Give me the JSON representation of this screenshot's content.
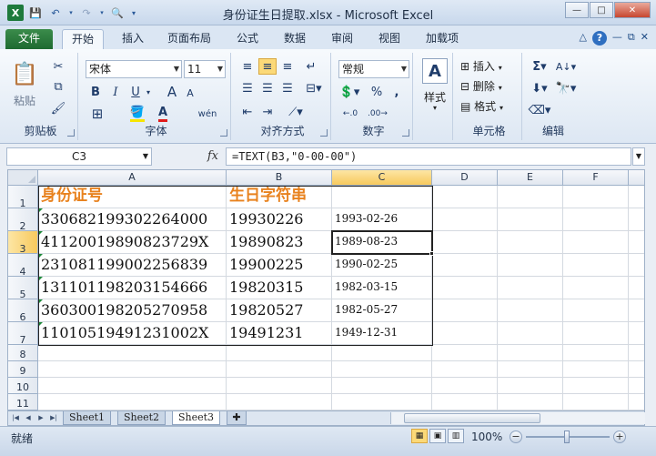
{
  "window": {
    "title": "身份证生日提取.xlsx  -  Microsoft Excel",
    "app_icon_letter": "X",
    "minimize": "—",
    "maximize": "□",
    "close": "✕"
  },
  "ribbon_tabs": [
    {
      "label": "文件"
    },
    {
      "label": "开始"
    },
    {
      "label": "插入"
    },
    {
      "label": "页面布局"
    },
    {
      "label": "公式"
    },
    {
      "label": "数据"
    },
    {
      "label": "审阅"
    },
    {
      "label": "视图"
    },
    {
      "label": "加载项"
    }
  ],
  "active_tab": "开始",
  "ribbon": {
    "clipboard": {
      "label": "剪贴板",
      "paste": "粘贴"
    },
    "font": {
      "label": "字体",
      "name": "宋体",
      "size": "11",
      "bold": "B",
      "italic": "I",
      "underline": "U",
      "grow": "A",
      "shrink": "A"
    },
    "alignment": {
      "label": "对齐方式"
    },
    "number": {
      "label": "数字",
      "format": "常规",
      "percent": "%",
      "comma": ","
    },
    "styles": {
      "label": "样式"
    },
    "cells": {
      "label": "单元格",
      "insert": "插入",
      "delete": "删除",
      "format": "格式"
    },
    "editing": {
      "label": "编辑"
    }
  },
  "formula_bar": {
    "name_box": "C3",
    "fx": "fx",
    "formula": "=TEXT(B3,\"0-00-00\")"
  },
  "grid": {
    "columns": [
      "A",
      "B",
      "C",
      "D",
      "E",
      "F"
    ],
    "rows": [
      "1",
      "2",
      "3",
      "4",
      "5",
      "6",
      "7",
      "8",
      "9",
      "10",
      "11"
    ],
    "header_row": {
      "a": "身份证号",
      "b": "生日字符串",
      "c": ""
    },
    "data": [
      {
        "a": "330682199302264000",
        "b": "19930226",
        "c": "1993-02-26"
      },
      {
        "a": "41120019890823729X",
        "b": "19890823",
        "c": "1989-08-23"
      },
      {
        "a": "231081199002256839",
        "b": "19900225",
        "c": "1990-02-25"
      },
      {
        "a": "131101198203154666",
        "b": "19820315",
        "c": "1982-03-15"
      },
      {
        "a": "360300198205270958",
        "b": "19820527",
        "c": "1982-05-27"
      },
      {
        "a": "11010519491231002X",
        "b": "19491231",
        "c": "1949-12-31"
      }
    ],
    "selected_cell": "C3",
    "header_color": "#e8821e"
  },
  "sheets": [
    "Sheet1",
    "Sheet2",
    "Sheet3"
  ],
  "active_sheet": "Sheet3",
  "status": {
    "ready": "就绪",
    "zoom": "100%",
    "zoom_minus": "−",
    "zoom_plus": "+"
  }
}
